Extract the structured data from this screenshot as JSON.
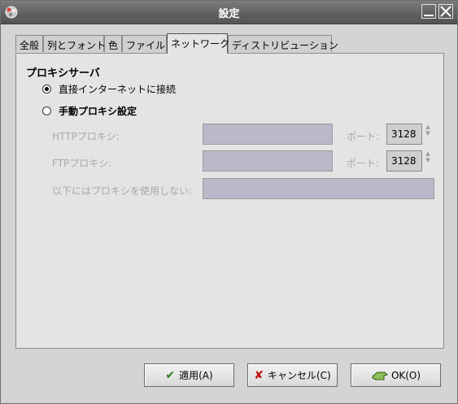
{
  "window": {
    "title": "設定"
  },
  "tabs": [
    {
      "label": "全般"
    },
    {
      "label": "列とフォント"
    },
    {
      "label": "色"
    },
    {
      "label": "ファイル"
    },
    {
      "label": "ネットワーク",
      "active": true
    },
    {
      "label": "ディストリビューション"
    }
  ],
  "proxy": {
    "section_title": "プロキシサーバ",
    "option_direct": "直接インターネットに接続",
    "option_manual": "手動プロキシ設定",
    "selected": "direct",
    "http_label": "HTTPプロキシ:",
    "http_value": "",
    "http_port_label": "ポート:",
    "http_port_value": "3128",
    "ftp_label": "FTPプロキシ:",
    "ftp_value": "",
    "ftp_port_label": "ポート:",
    "ftp_port_value": "3128",
    "no_proxy_label": "以下にはプロキシを使用しない:",
    "no_proxy_value": ""
  },
  "buttons": {
    "apply_label": "適用(A)",
    "cancel_label": "キャンセル(C)",
    "ok_label": "OK(O)"
  },
  "colors": {
    "titlebar": "#5f5f5f",
    "disabled_input": "#b9b9c9",
    "panel": "#e4e4e4"
  },
  "icons": {
    "app": "app-logo-icon",
    "minimize": "minimize-icon",
    "close": "close-icon",
    "apply": "checkmark-icon",
    "cancel": "x-mark-icon",
    "ok": "ok-hand-icon"
  }
}
